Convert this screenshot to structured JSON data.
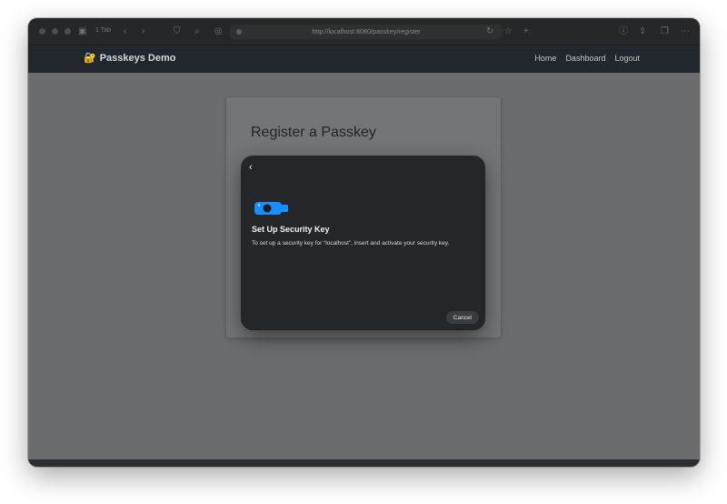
{
  "browser": {
    "tab_count": "1 Tab",
    "url": "http://localhost:8080/passkey/register"
  },
  "site": {
    "brand": "Passkeys Demo",
    "brand_icon": "lock-key-icon",
    "nav": [
      "Home",
      "Dashboard",
      "Logout"
    ]
  },
  "page": {
    "title": "Register a Passkey"
  },
  "dialog": {
    "title": "Set Up Security Key",
    "description": "To set up a security key for “localhost”, insert and activate your security key.",
    "cancel_label": "Cancel",
    "accent_color": "#1a8cff"
  }
}
